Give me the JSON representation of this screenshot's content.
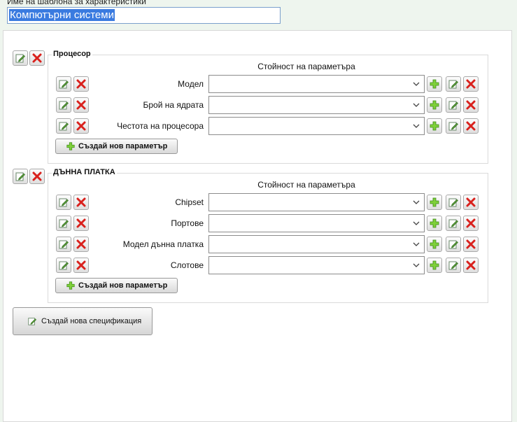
{
  "template_name_label": "Име на шаблона за характеристики",
  "template_name_value": "Компютърни системи",
  "value_column_header": "Стойност на параметъра",
  "add_parameter_label": "Създай нов параметър",
  "new_spec_label": "Създай нова спецификация",
  "icons": {
    "edit": "edit-icon",
    "delete": "delete-icon",
    "add": "add-icon",
    "dropdown": "chevron-down-icon"
  },
  "colors": {
    "selection": "#3a7be0",
    "delete_red": "#d9211d",
    "add_green": "#6cc02a"
  },
  "sections": [
    {
      "title": "Процесор",
      "params": [
        {
          "label": "Модел",
          "value": ""
        },
        {
          "label": "Брой на ядрата",
          "value": ""
        },
        {
          "label": "Честота на процесора",
          "value": ""
        }
      ]
    },
    {
      "title": "ДЪННА ПЛАТКА",
      "params": [
        {
          "label": "Chipset",
          "value": ""
        },
        {
          "label": "Портове",
          "value": ""
        },
        {
          "label": "Модел дънна платка",
          "value": ""
        },
        {
          "label": "Слотове",
          "value": ""
        }
      ]
    }
  ]
}
